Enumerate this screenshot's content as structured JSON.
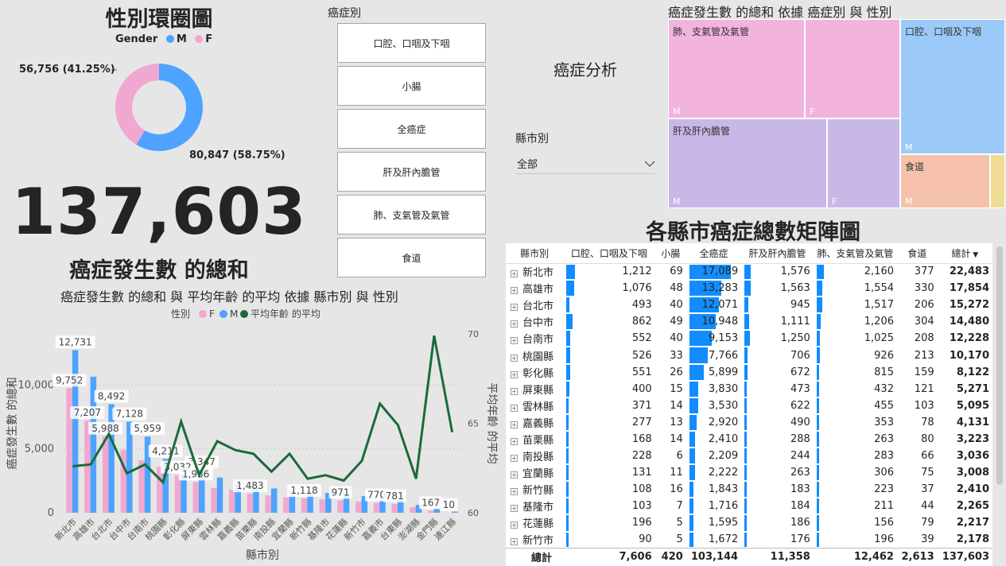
{
  "donut": {
    "title": "性別環圈圖",
    "legend_title": "Gender",
    "legend": [
      {
        "label": "M",
        "color": "#4da3ff"
      },
      {
        "label": "F",
        "color": "#f0a8d0"
      }
    ],
    "values": [
      {
        "gender": "M",
        "value": 80847
      },
      {
        "gender": "F",
        "value": 56756
      }
    ],
    "label_f": "56,756 (41.25%)",
    "label_m": "80,847 (58.75%)"
  },
  "kpi": {
    "value": "137,603",
    "label": "癌症發生數 的總和"
  },
  "slicer": {
    "title": "癌症別",
    "options": [
      "口腔、口咽及下咽",
      "小腸",
      "全癌症",
      "肝及肝內膽管",
      "肺、支氣管及氣管",
      "食道"
    ]
  },
  "report_title": "癌症分析",
  "county_filter": {
    "label": "縣市別",
    "value": "全部",
    "icon": "chevron-down-icon"
  },
  "treemap": {
    "title": "癌症發生數 的總和 依據 癌症別 與 性別",
    "cells": [
      {
        "name": "肺、支氣管及氣管",
        "sub": "M"
      },
      {
        "name": "",
        "sub": "F"
      },
      {
        "name": "口腔、口咽及下咽",
        "sub": "M"
      },
      {
        "name": "肝及肝內膽管",
        "sub": "M"
      },
      {
        "name": "",
        "sub": "F"
      },
      {
        "name": "食道",
        "sub": "M"
      }
    ],
    "colors": {
      "lung": "#f2b3dd",
      "oral": "#9ccaf8",
      "liver": "#c9b7e8",
      "eso": "#f5c1ab",
      "small": "#f0dd94"
    }
  },
  "matrix": {
    "title": "各縣市癌症總數矩陣圖",
    "headers": [
      "縣市別",
      "口腔、口咽及下咽",
      "小腸",
      "全癌症",
      "肝及肝內膽管",
      "肺、支氣管及氣管",
      "食道",
      "總計"
    ],
    "rows": [
      [
        "新北市",
        "1,212",
        "69",
        "17,089",
        "1,576",
        "2,160",
        "377",
        "22,483"
      ],
      [
        "高雄市",
        "1,076",
        "48",
        "13,283",
        "1,563",
        "1,554",
        "330",
        "17,854"
      ],
      [
        "台北市",
        "493",
        "40",
        "12,071",
        "945",
        "1,517",
        "206",
        "15,272"
      ],
      [
        "台中市",
        "862",
        "49",
        "10,948",
        "1,111",
        "1,206",
        "304",
        "14,480"
      ],
      [
        "台南市",
        "552",
        "40",
        "9,153",
        "1,250",
        "1,025",
        "208",
        "12,228"
      ],
      [
        "桃園縣",
        "526",
        "33",
        "7,766",
        "706",
        "926",
        "213",
        "10,170"
      ],
      [
        "彰化縣",
        "551",
        "26",
        "5,899",
        "672",
        "815",
        "159",
        "8,122"
      ],
      [
        "屏東縣",
        "400",
        "15",
        "3,830",
        "473",
        "432",
        "121",
        "5,271"
      ],
      [
        "雲林縣",
        "371",
        "14",
        "3,530",
        "622",
        "455",
        "103",
        "5,095"
      ],
      [
        "嘉義縣",
        "277",
        "13",
        "2,920",
        "490",
        "353",
        "78",
        "4,131"
      ],
      [
        "苗栗縣",
        "168",
        "14",
        "2,410",
        "288",
        "263",
        "80",
        "3,223"
      ],
      [
        "南投縣",
        "228",
        "6",
        "2,209",
        "244",
        "283",
        "66",
        "3,036"
      ],
      [
        "宜蘭縣",
        "131",
        "11",
        "2,222",
        "263",
        "306",
        "75",
        "3,008"
      ],
      [
        "新竹縣",
        "108",
        "16",
        "1,843",
        "183",
        "223",
        "37",
        "2,410"
      ],
      [
        "基隆市",
        "103",
        "7",
        "1,716",
        "184",
        "211",
        "44",
        "2,265"
      ],
      [
        "花蓮縣",
        "196",
        "5",
        "1,595",
        "186",
        "156",
        "79",
        "2,217"
      ],
      [
        "新竹市",
        "90",
        "5",
        "1,672",
        "176",
        "196",
        "39",
        "2,178"
      ]
    ],
    "total": [
      "總計",
      "7,606",
      "420",
      "103,144",
      "11,358",
      "12,462",
      "2,613",
      "137,603"
    ]
  },
  "chart_data": {
    "type": "bar",
    "title": "癌症發生數 的總和 與 平均年齡 的平均 依據 縣市別 與 性別",
    "xlabel": "縣市別",
    "ylabel": "癌症發生數 的總和",
    "y2label": "平均年齡 的平均",
    "legend_title": "性別",
    "legend": [
      "F",
      "M",
      "平均年齡 的平均"
    ],
    "categories": [
      "新北市",
      "高雄市",
      "台北市",
      "台中市",
      "台南市",
      "桃園縣",
      "彰化縣",
      "屏東縣",
      "雲林縣",
      "嘉義縣",
      "苗栗縣",
      "南投縣",
      "宜蘭縣",
      "新竹縣",
      "基隆市",
      "花蓮縣",
      "新竹市",
      "嘉義市",
      "台東縣",
      "澎湖縣",
      "金門縣",
      "連江縣"
    ],
    "ylim": [
      0,
      14000
    ],
    "yticks": [
      "0",
      "5,000",
      "10,000"
    ],
    "y2lim": [
      60,
      70
    ],
    "y2ticks": [
      "60",
      "65",
      "70"
    ],
    "series": [
      {
        "name": "F",
        "color": "#f0a8d0",
        "values": [
          9752,
          7207,
          5988,
          4900,
          4100,
          3600,
          2950,
          2400,
          1936,
          1800,
          1483,
          1350,
          1200,
          1118,
          1050,
          971,
          880,
          770,
          700,
          430,
          167,
          10
        ]
      },
      {
        "name": "M",
        "color": "#4da3ff",
        "values": [
          12731,
          10647,
          8492,
          7128,
          5959,
          4211,
          3032,
          3347,
          2750,
          2300,
          2030,
          1900,
          1700,
          1650,
          1550,
          1480,
          1300,
          1150,
          1000,
          620,
          330,
          90
        ]
      },
      {
        "name": "平均年齡 的平均",
        "color": "#1a6b3a",
        "values": [
          62.6,
          62.7,
          64.4,
          62.2,
          62.7,
          61.7,
          65.1,
          62.1,
          64.0,
          63.5,
          63.3,
          62.3,
          63.3,
          61.9,
          62.1,
          61.8,
          62.9,
          66.1,
          64.9,
          61.9,
          69.9,
          64.5
        ]
      }
    ],
    "data_labels": {
      "M": [
        "12,731",
        "",
        "8,492",
        "7,128",
        "5,959",
        "4,211",
        "",
        "3,347",
        "",
        "",
        "",
        "",
        "",
        "",
        "",
        "",
        "",
        "",
        "",
        "",
        "",
        ""
      ],
      "F": [
        "9,752",
        "7,207",
        "5,988",
        "",
        "",
        "",
        "3,032",
        "1,936",
        "",
        "",
        "1,483",
        "",
        "",
        "1,118",
        "",
        "971",
        "",
        "770",
        "781",
        "",
        "167",
        "10"
      ]
    }
  }
}
